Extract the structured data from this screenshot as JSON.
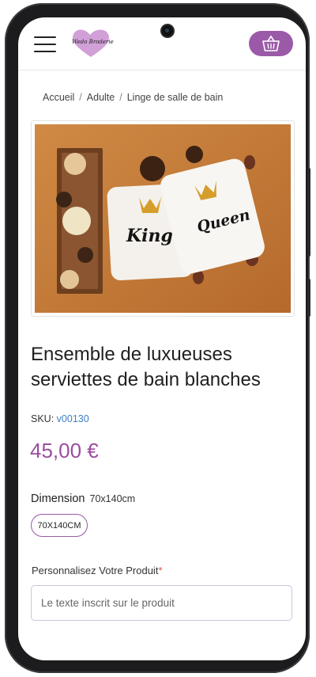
{
  "header": {
    "logo_text": "Wedo Broderie",
    "menu_icon": "hamburger-menu-icon",
    "cart_icon": "shopping-basket-icon"
  },
  "breadcrumb": {
    "items": [
      "Accueil",
      "Adulte",
      "Linge de salle de bain"
    ],
    "separator": "/"
  },
  "product": {
    "image_towel_left": "King",
    "image_towel_right": "Queen",
    "title": "Ensemble de luxueuses serviettes de bain blanches",
    "sku_label": "SKU:",
    "sku_value": "v00130",
    "price": "45,00 €",
    "dimension_label": "Dimension",
    "dimension_selected": "70x140cm",
    "dimension_options": [
      "70X140CM"
    ],
    "personalize_label": "Personnalisez Votre Produit",
    "required_mark": "*",
    "personalize_placeholder": "Le texte inscrit sur le produit"
  },
  "colors": {
    "accent": "#9b5aa8",
    "price": "#9b4d9f",
    "sku_link": "#3b7fc4"
  }
}
